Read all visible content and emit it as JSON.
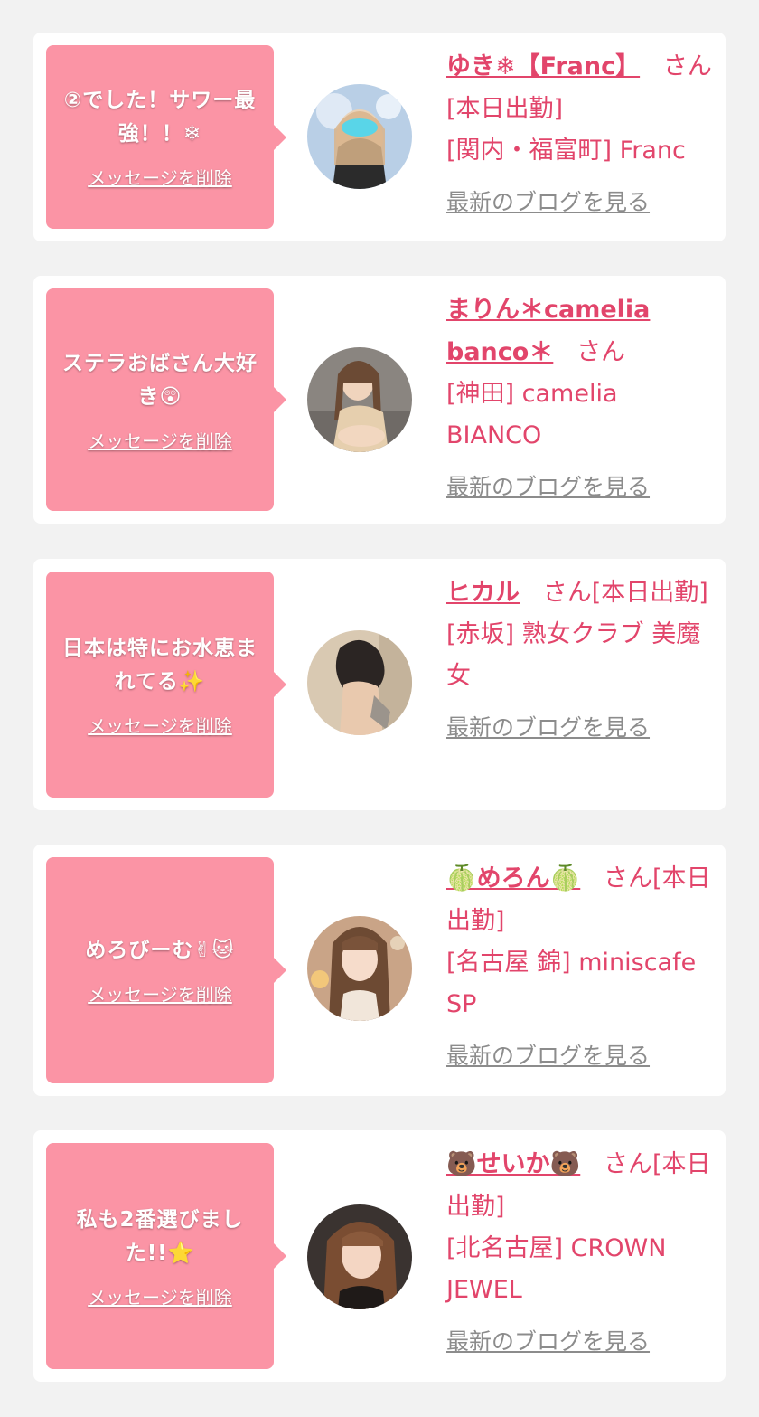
{
  "delete_label": "メッセージを削除",
  "blog_label": "最新のブログを見る",
  "san_label": "さん",
  "colors": {
    "background": "#f2f2f2",
    "bubble": "#fb94a5",
    "accent": "#e2456b",
    "link_gray": "#8c8c8c"
  },
  "cards": [
    {
      "message": "②でした！サワー最強！！❄",
      "name": "ゆき❄【Franc】",
      "suffix": "さん[本日出勤]",
      "shop": "[関内・福富町] Franc"
    },
    {
      "message": "ステラおばさん大好き😲",
      "name": "まりん＊camelia banco＊",
      "suffix": "さん",
      "shop": "[神田] camelia BIANCO"
    },
    {
      "message": "日本は特にお水恵まれてる✨",
      "name": "ヒカル",
      "suffix": "さん[本日出勤]",
      "shop": "[赤坂] 熟女クラブ 美魔女"
    },
    {
      "message": "めろびーむ✌🐱",
      "name": "🍈めろん🍈",
      "suffix": "さん[本日出勤]",
      "shop": "[名古屋 錦] miniscafe SP"
    },
    {
      "message": "私も2番選びました!!⭐",
      "name": "🐻せいか🐻",
      "suffix": "さん[本日出勤]",
      "shop": "[北名古屋] CROWN JEWEL"
    }
  ]
}
